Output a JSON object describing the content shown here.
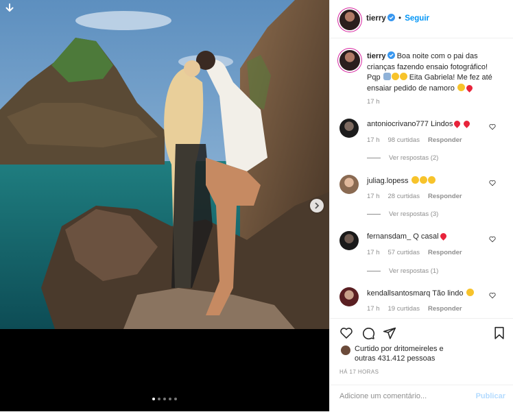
{
  "post": {
    "author": "tierry",
    "follow_label": "Seguir",
    "dot_separator": "•",
    "caption": "Boa noite com o pai das crianças fazendo ensaio fotográfico! Pqp",
    "caption_tail": "Eita Gabriela! Me fez até ensaiar pedido de namoro",
    "caption_time": "17 h",
    "likes_prefix": "Curtido por",
    "likes_user": "dritomeireles",
    "likes_connector": "e",
    "likes_others": "outras 431.412 pessoas",
    "timestamp": "HÁ 17 HORAS",
    "carousel": {
      "slides": 5,
      "active": 0
    }
  },
  "comments": [
    {
      "user": "antoniocrivano777",
      "text": "Lindos",
      "emojis": [
        "r",
        "r"
      ],
      "time": "17 h",
      "likes": "98 curtidas",
      "reply": "Responder",
      "view_replies": "Ver respostas (2)"
    },
    {
      "user": "juliag.lopess",
      "text": "",
      "emojis": [
        "y",
        "y",
        "y"
      ],
      "time": "17 h",
      "likes": "28 curtidas",
      "reply": "Responder",
      "view_replies": "Ver respostas (3)"
    },
    {
      "user": "fernansdam_",
      "text": "Q casal",
      "emojis": [
        "r"
      ],
      "time": "17 h",
      "likes": "57 curtidas",
      "reply": "Responder",
      "view_replies": "Ver respostas (1)"
    },
    {
      "user": "kendallsantosmarq",
      "text": "Tão lindo",
      "emojis": [
        "y"
      ],
      "time": "17 h",
      "likes": "19 curtidas",
      "reply": "Responder",
      "view_replies": ""
    }
  ],
  "add_comment": {
    "placeholder": "Adicione um comentário...",
    "post_label": "Publicar"
  },
  "colors": {
    "link": "#0095f6",
    "muted": "#8e8e8e",
    "heart": "#e8243b",
    "post_disabled": "#b3dbff"
  }
}
